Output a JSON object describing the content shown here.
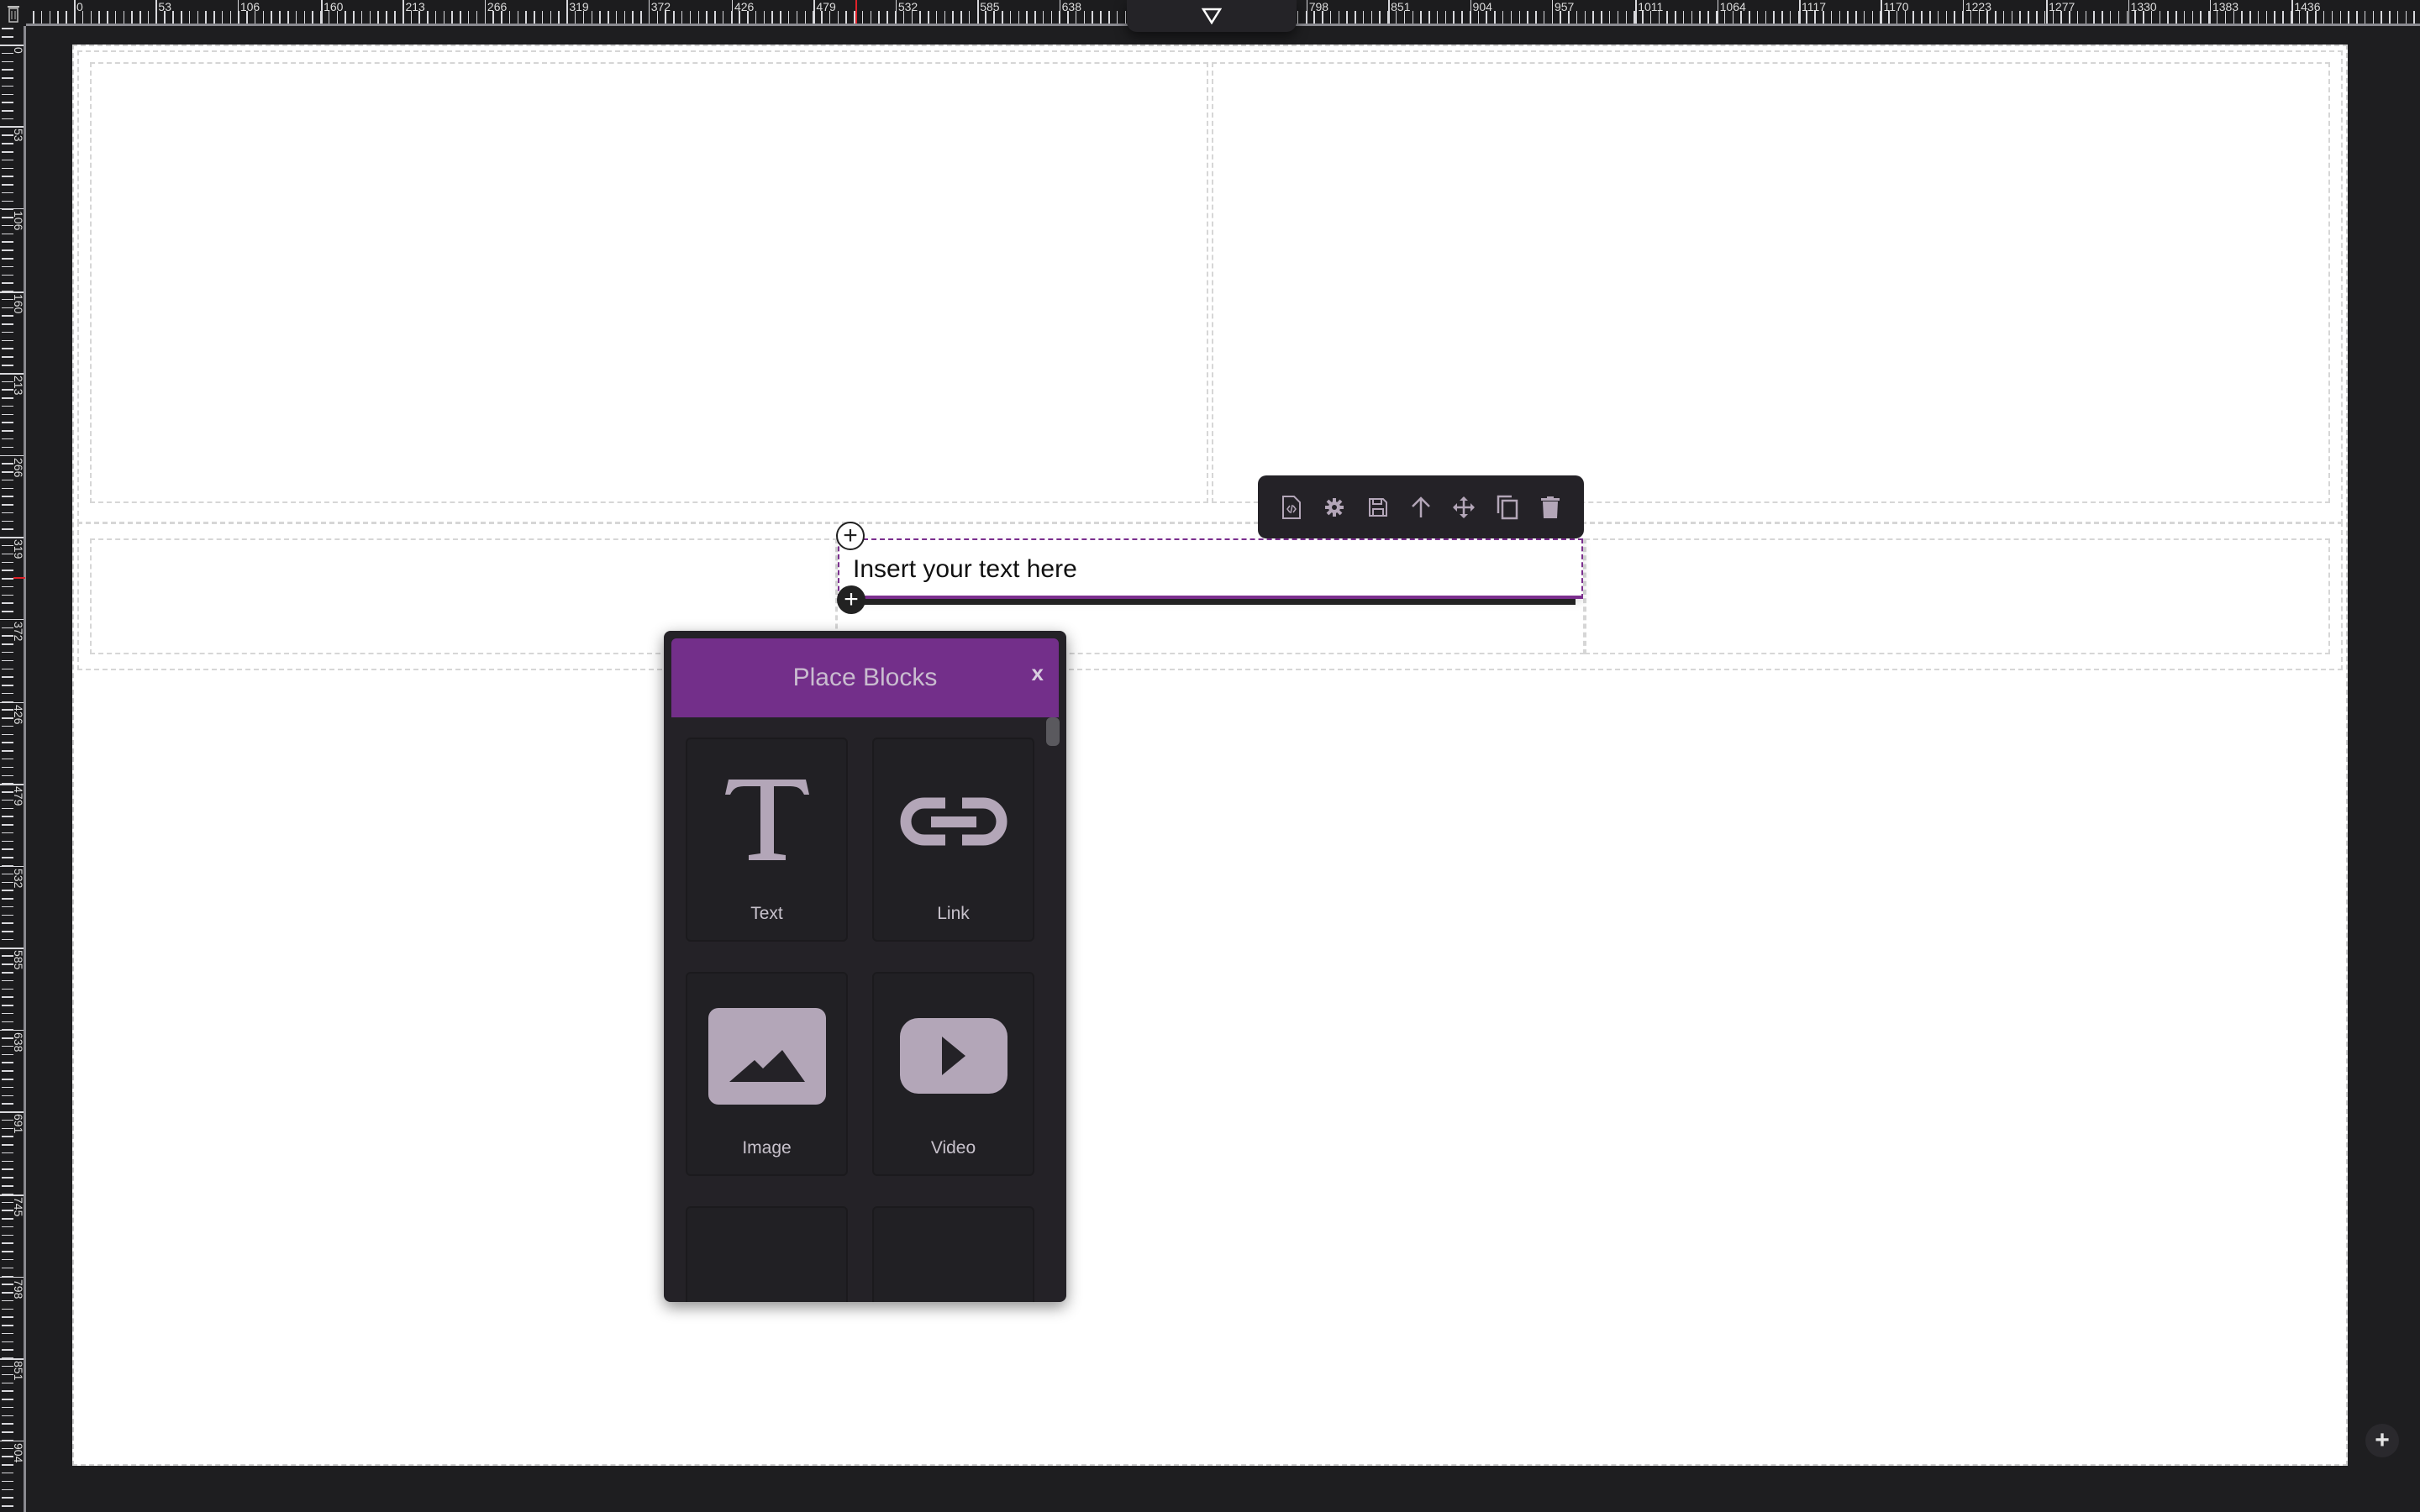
{
  "rulers": {
    "top_labels": [
      "0",
      "53",
      "106",
      "160",
      "213",
      "266",
      "319",
      "372",
      "426",
      "479",
      "532",
      "585",
      "638",
      "798",
      "851",
      "904",
      "957",
      "1011",
      "1064",
      "1117",
      "1170",
      "1223",
      "1277",
      "1330",
      "1383",
      "1436"
    ],
    "left_labels": [
      "0",
      "53",
      "106",
      "160",
      "213",
      "266",
      "319",
      "372",
      "426",
      "479",
      "532",
      "585",
      "638",
      "691",
      "745",
      "798",
      "851",
      "904"
    ],
    "cursor_color": "#e0222a"
  },
  "toolbar": {
    "items": [
      {
        "icon": "code-file-icon"
      },
      {
        "icon": "gear-icon"
      },
      {
        "icon": "save-icon"
      },
      {
        "icon": "arrow-up-icon"
      },
      {
        "icon": "move-icon"
      },
      {
        "icon": "copy-icon"
      },
      {
        "icon": "trash-icon"
      }
    ]
  },
  "text_block": {
    "content": "Insert your text here"
  },
  "place_blocks": {
    "title": "Place Blocks",
    "close_label": "x",
    "accent": "#732f8a",
    "blocks": [
      {
        "label": "Text",
        "icon": "text-icon"
      },
      {
        "label": "Link",
        "icon": "link-icon"
      },
      {
        "label": "Image",
        "icon": "image-icon"
      },
      {
        "label": "Video",
        "icon": "video-icon"
      },
      {
        "label": "",
        "icon": "columns-icon"
      },
      {
        "label": "",
        "icon": "form-icon"
      }
    ]
  },
  "colors": {
    "icon": "#b3a6b8",
    "background": "#1e1e20",
    "panel": "#242227"
  }
}
